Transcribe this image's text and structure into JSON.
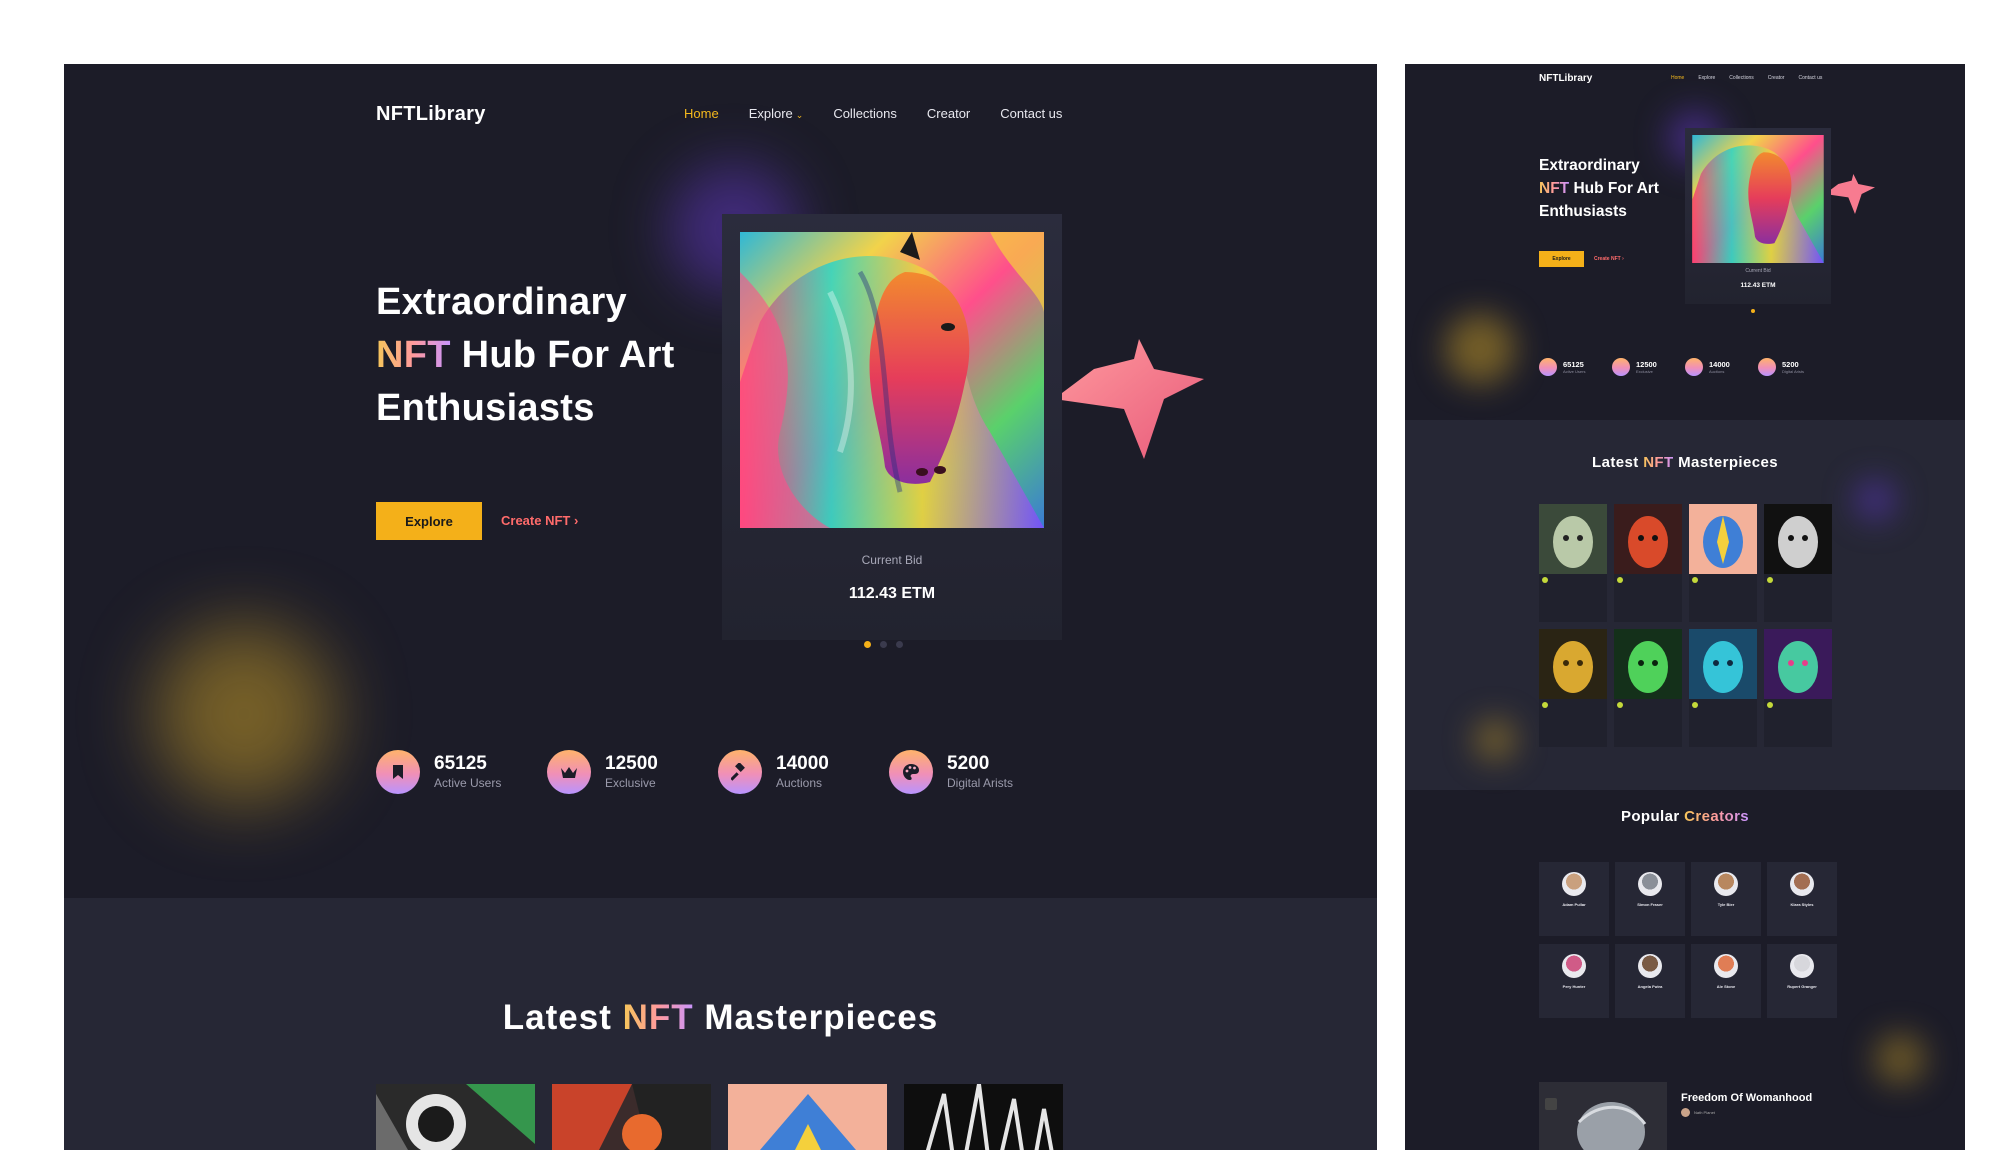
{
  "main": {
    "logo": "NFTLibrary",
    "nav": [
      {
        "label": "Home",
        "active": true
      },
      {
        "label": "Explore",
        "has_dropdown": true
      },
      {
        "label": "Collections"
      },
      {
        "label": "Creator"
      },
      {
        "label": "Contact us"
      }
    ],
    "hero": {
      "title_line1": "Extraordinary",
      "title_highlight": "NFT",
      "title_line2_rest": " Hub For Art",
      "title_line3": "Enthusiasts",
      "explore_label": "Explore",
      "create_label": "Create NFT",
      "create_icon": "chevron-right-icon"
    },
    "featured_card": {
      "bid_label": "Current Bid",
      "bid_value": "112.43 ETM"
    },
    "carousel": {
      "count": 3,
      "active": 0
    },
    "stats": [
      {
        "value": "65125",
        "label": "Active Users",
        "icon": "bookmark-icon"
      },
      {
        "value": "12500",
        "label": "Exclusive",
        "icon": "crown-icon"
      },
      {
        "value": "14000",
        "label": "Auctions",
        "icon": "gavel-icon"
      },
      {
        "value": "5200",
        "label": "Digital Arists",
        "icon": "palette-icon"
      }
    ],
    "latest": {
      "title_before": "Latest ",
      "title_highlight": "NFT",
      "title_after": " Masterpieces"
    }
  },
  "side": {
    "logo": "NFTLibrary",
    "nav": [
      "Home",
      "Explore",
      "Collections",
      "Creator",
      "Contact us"
    ],
    "hero": {
      "title_line1": "Extraordinary",
      "title_highlight": "NFT",
      "title_line2_rest": " Hub For Art",
      "title_line3": "Enthusiasts",
      "explore_label": "Explore",
      "create_label": "Create NFT"
    },
    "featured_card": {
      "bid_label": "Current Bid",
      "bid_value": "112.43 ETM"
    },
    "stats": [
      {
        "value": "65125",
        "label": "Active Users"
      },
      {
        "value": "12500",
        "label": "Exclusive"
      },
      {
        "value": "14000",
        "label": "Auctions"
      },
      {
        "value": "5200",
        "label": "Digital Arists"
      }
    ],
    "latest": {
      "title_before": "Latest ",
      "title_highlight": "NFT",
      "title_after": " Masterpieces"
    },
    "popular": {
      "title_before": "Popular ",
      "title_highlight": "Creators"
    },
    "creators": [
      {
        "name": "Adam Pullar",
        "avatar_color": "#c9a07e"
      },
      {
        "name": "Simon Fraser",
        "avatar_color": "#8a8f98"
      },
      {
        "name": "Tyle Bier",
        "avatar_color": "#b8875f"
      },
      {
        "name": "Klara Styles",
        "avatar_color": "#a36e52"
      },
      {
        "name": "Pery Hunter",
        "avatar_color": "#d05b87"
      },
      {
        "name": "Angela Putra",
        "avatar_color": "#7a5b45"
      },
      {
        "name": "Ale Stone",
        "avatar_color": "#e07d55"
      },
      {
        "name": "Rupert Granger",
        "avatar_color": "#d7d7dc"
      }
    ],
    "feature": {
      "title": "Freedom Of Womanhood",
      "author": "Nath Planet"
    }
  },
  "colors": {
    "background": "#1c1c28",
    "section": "#262735",
    "accent": "#f4b019",
    "link": "#ff6b6b"
  }
}
